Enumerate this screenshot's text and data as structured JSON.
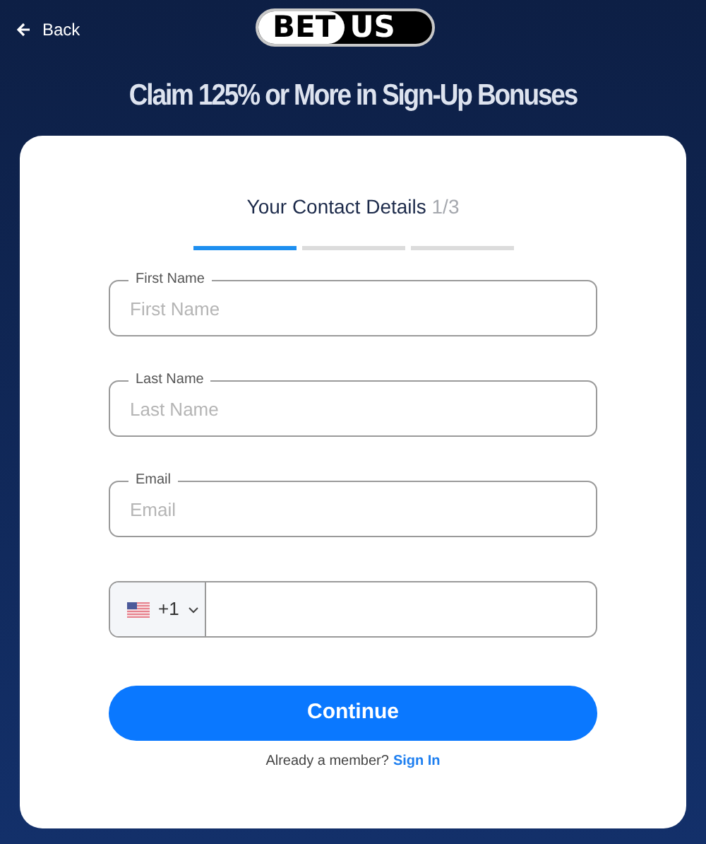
{
  "header": {
    "back": "Back",
    "logo": [
      "BET",
      "US"
    ]
  },
  "headline": "Claim 125% or More in Sign-Up Bonuses",
  "form": {
    "title": "Your Contact Details",
    "step": "1/3",
    "steps": [
      {
        "active": true
      },
      {
        "active": false
      },
      {
        "active": false
      }
    ],
    "fields": [
      {
        "kind": "text",
        "label": "First Name",
        "placeholder": "First Name"
      },
      {
        "kind": "text",
        "label": "Last Name",
        "placeholder": "Last Name"
      },
      {
        "kind": "text",
        "label": "Email",
        "placeholder": "Email"
      },
      {
        "kind": "phone",
        "code": "+1"
      }
    ],
    "submit": "Continue",
    "footer": "Already a member?",
    "link": "Sign In"
  }
}
